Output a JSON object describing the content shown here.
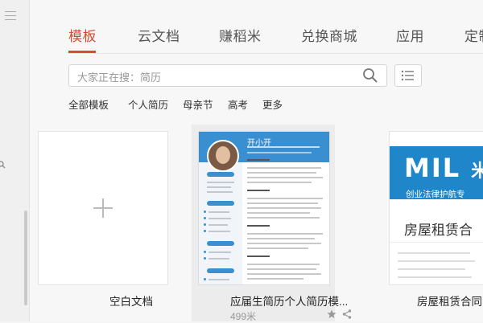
{
  "tabs": [
    {
      "label": "模板",
      "active": true
    },
    {
      "label": "云文档",
      "active": false
    },
    {
      "label": "赚稻米",
      "active": false
    },
    {
      "label": "兑换商城",
      "active": false
    },
    {
      "label": "应用",
      "active": false
    },
    {
      "label": "定制",
      "active": false
    }
  ],
  "search": {
    "placeholder": "大家正在搜：简历"
  },
  "filters": [
    "全部模板",
    "个人简历",
    "母亲节",
    "高考",
    "更多"
  ],
  "cards": {
    "blank": {
      "label": "空白文档"
    },
    "resume": {
      "label": "应届生简历个人简历模...",
      "price": "499米",
      "preview_name": "开小开"
    },
    "milan": {
      "label": "房屋租赁合同",
      "logo": "MIL",
      "logo_tail": "米",
      "subtitle": "创业法律护航专",
      "preview_title": "房屋租赁合"
    }
  },
  "colors": {
    "accent": "#d84a32",
    "resume_blue": "#3a8fd0",
    "milan_blue": "#1f86c9"
  },
  "icons": [
    "menu-icon",
    "search-icon",
    "list-view-icon",
    "plus-icon",
    "star-icon",
    "share-icon"
  ]
}
